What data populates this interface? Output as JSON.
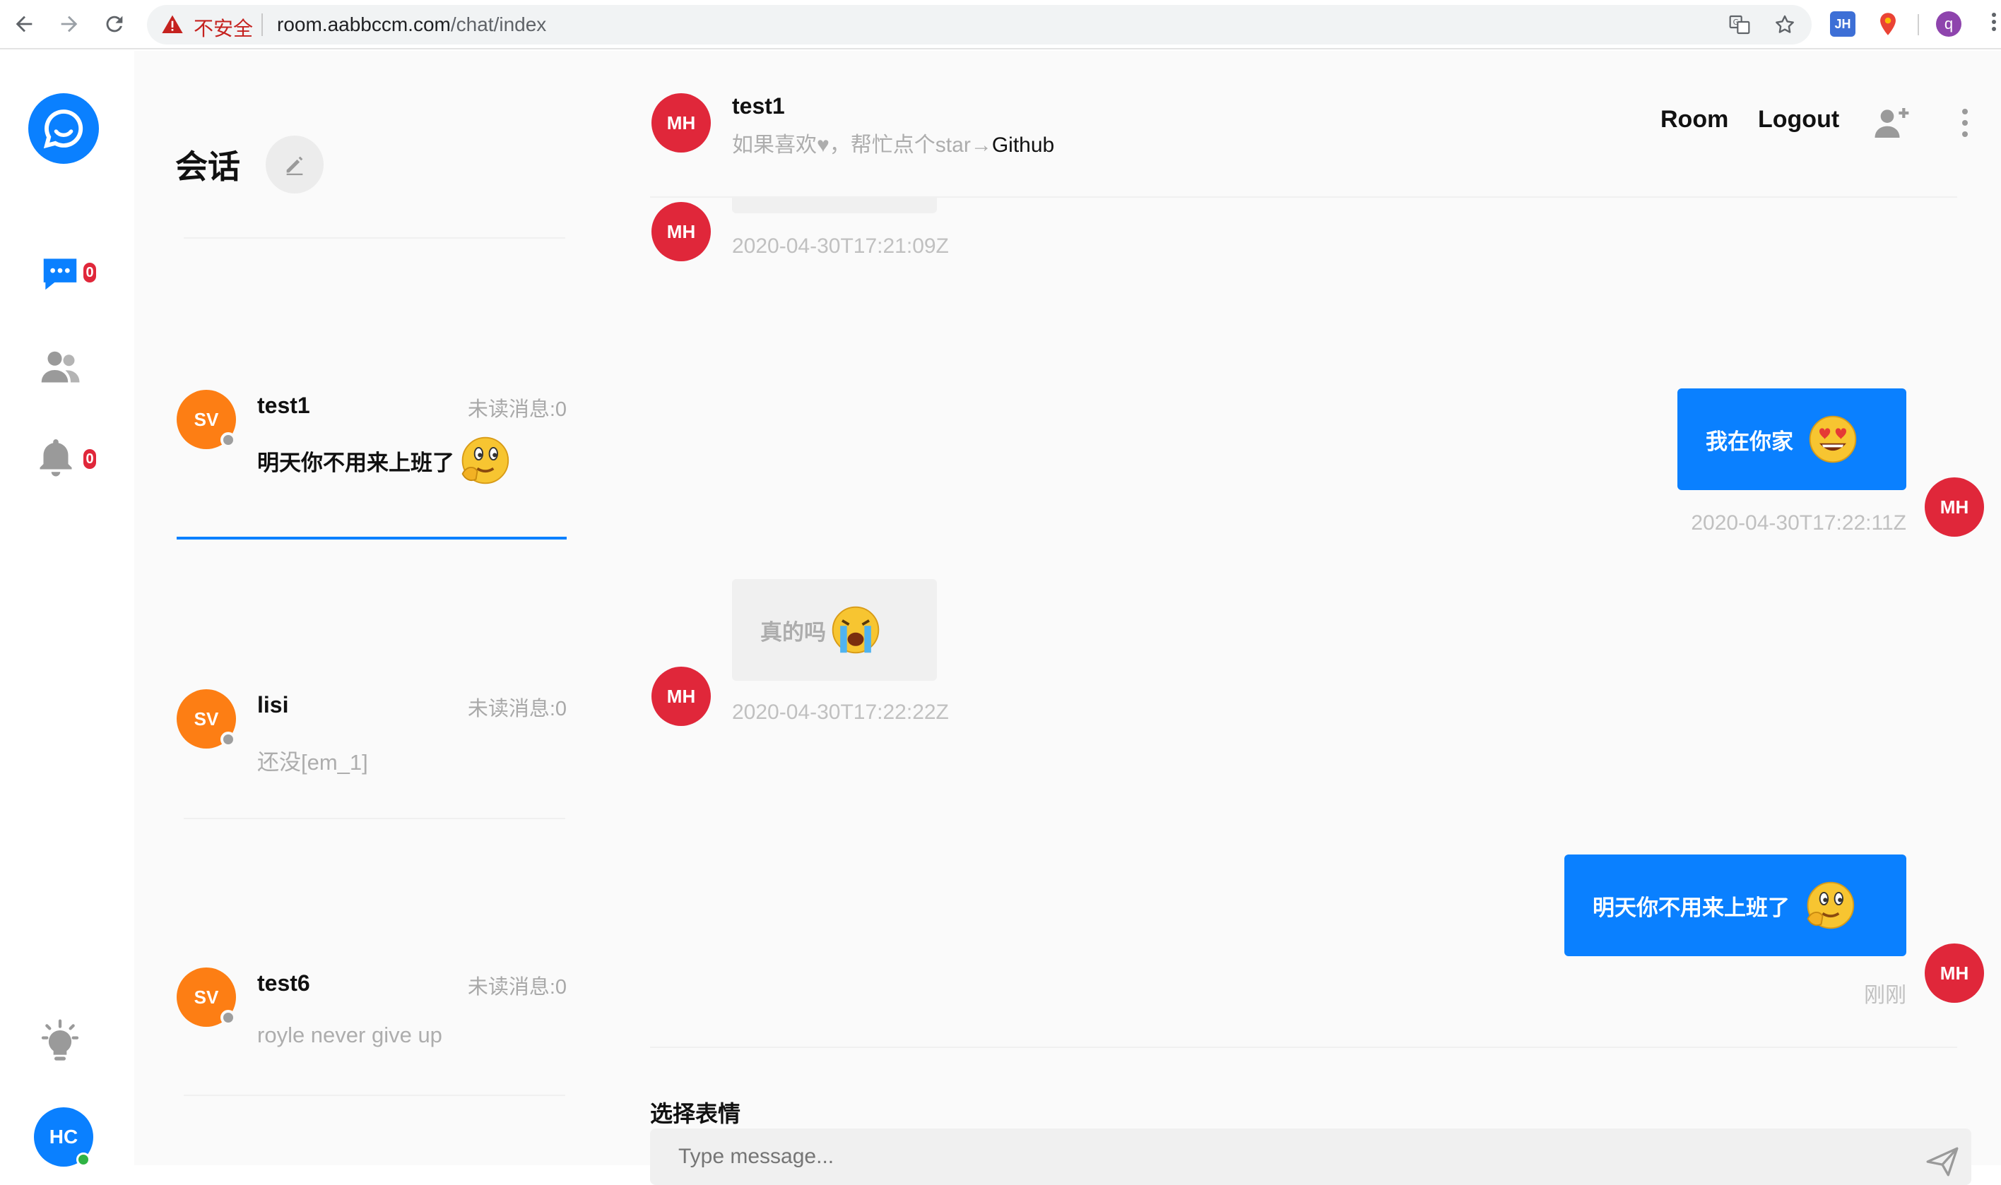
{
  "browser": {
    "insecure_label": "不安全",
    "url_host": "room.aabbccm.com",
    "url_path": "/chat/index",
    "extension_jh": "JH",
    "profile_initial": "q"
  },
  "rail": {
    "chats_badge": "0",
    "notifications_badge": "0",
    "user_initials": "HC"
  },
  "sidebar": {
    "title": "会话",
    "conversations": [
      {
        "initials": "SV",
        "name": "test1",
        "unread": "未读消息:0",
        "message": "明天你不用来上班了"
      },
      {
        "initials": "SV",
        "name": "lisi",
        "unread": "未读消息:0",
        "message": "还没[em_1]"
      },
      {
        "initials": "SV",
        "name": "test6",
        "unread": "未读消息:0",
        "message": "royle never give up"
      }
    ]
  },
  "chat": {
    "header": {
      "initials": "MH",
      "name": "test1",
      "subtitle": "如果喜欢♥，帮忙点个star→",
      "subtitle_link": "Github",
      "room_link": "Room",
      "logout_link": "Logout"
    },
    "messages": [
      {
        "side": "left",
        "initials": "MH",
        "text": "",
        "time": "2020-04-30T17:21:09Z"
      },
      {
        "side": "right",
        "initials": "MH",
        "text": "我在你家",
        "emoji": "heart-eyes",
        "time": "2020-04-30T17:22:11Z"
      },
      {
        "side": "left",
        "initials": "MH",
        "text": "真的吗",
        "emoji": "crying",
        "time": "2020-04-30T17:22:22Z"
      },
      {
        "side": "right",
        "initials": "MH",
        "text": "明天你不用来上班了",
        "emoji": "thinking",
        "time": "刚刚"
      }
    ],
    "emoji_picker_label": "选择表情",
    "input_placeholder": "Type message..."
  },
  "colors": {
    "accent": "#0a80ff",
    "avatar_orange": "#fd7e14",
    "avatar_red": "#e0273a",
    "badge_red": "#e0273a",
    "online_green": "#2fb344"
  }
}
